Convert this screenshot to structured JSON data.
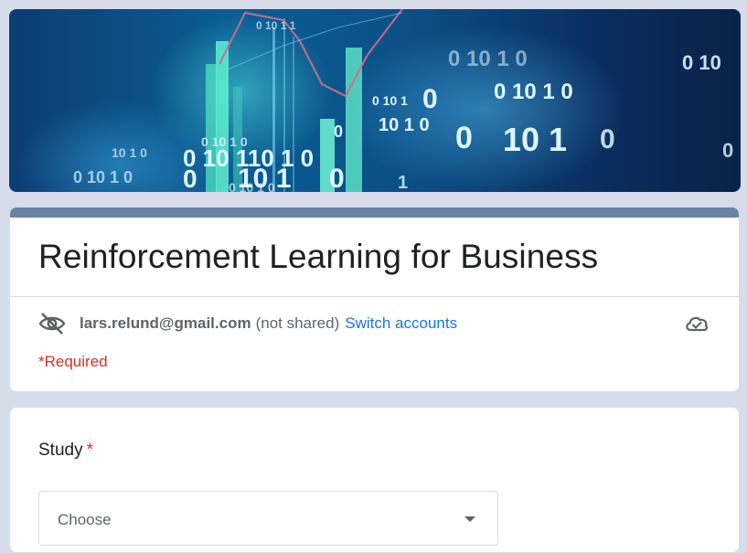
{
  "banner": {
    "image_name": "binary-data-chart-banner"
  },
  "form": {
    "title": "Reinforcement Learning for Business",
    "account": {
      "email": "lars.relund@gmail.com",
      "not_shared": "(not shared)",
      "switch_label": "Switch accounts"
    },
    "required_note": "*Required"
  },
  "question": {
    "label": "Study",
    "required_mark": "*",
    "select_placeholder": "Choose"
  },
  "colors": {
    "accent_bar": "#6b84a6",
    "link": "#1a73e8",
    "required": "#d93025",
    "background": "#d6dcea"
  },
  "icons": [
    "eye-off-icon",
    "cloud-sync-icon",
    "dropdown-caret-icon"
  ]
}
